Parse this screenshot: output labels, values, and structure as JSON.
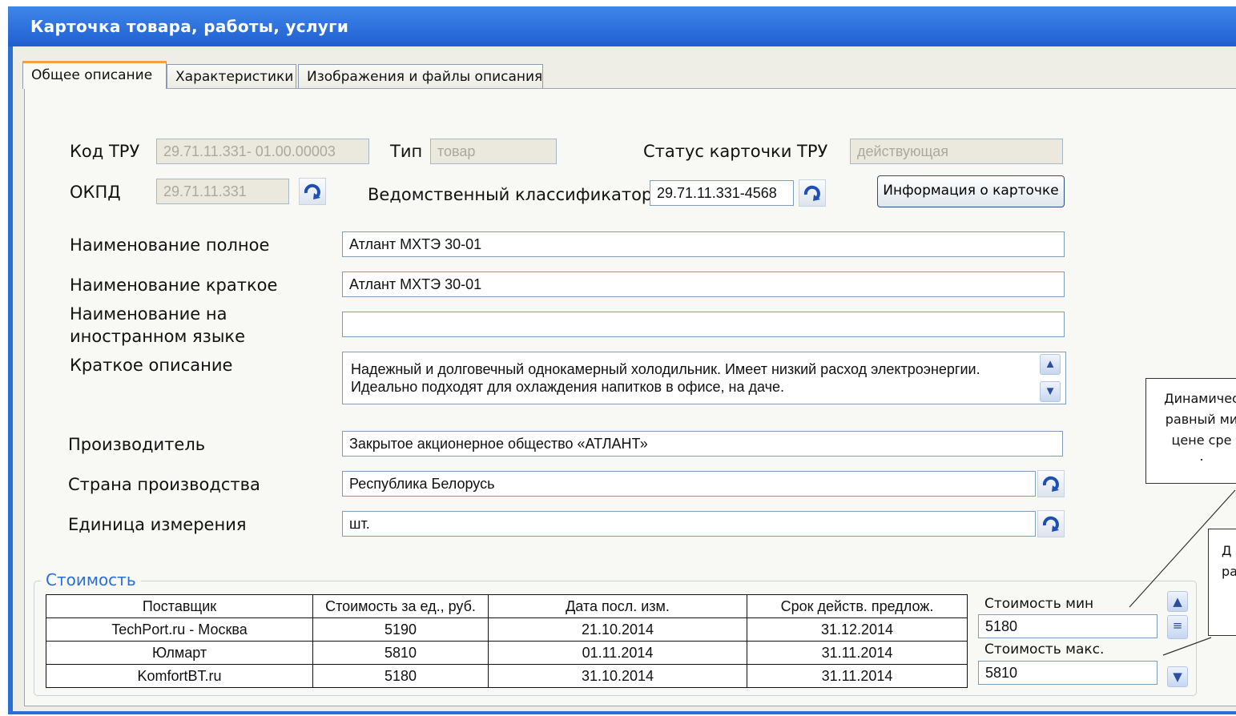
{
  "window": {
    "title": "Карточка товара, работы, услуги"
  },
  "tabs": [
    {
      "label": "Общее описание",
      "active": true
    },
    {
      "label": "Характеристики",
      "active": false
    },
    {
      "label": "Изображения и файлы описания",
      "active": false
    }
  ],
  "form": {
    "code": {
      "label": "Код ТРУ",
      "value": "29.71.11.331- 01.00.00003"
    },
    "type": {
      "label": "Тип",
      "value": "товар"
    },
    "status": {
      "label": "Статус карточки ТРУ",
      "value": "действующая"
    },
    "okpd": {
      "label": "ОКПД",
      "value": "29.71.11.331"
    },
    "dept_classifier": {
      "label": "Ведомственный классификатор",
      "value": "29.71.11.331-4568"
    },
    "info_button": "Информация о карточке",
    "name_full": {
      "label": "Наименование полное",
      "value": "Атлант МХТЭ 30-01"
    },
    "name_short": {
      "label": "Наименование краткое",
      "value": "Атлант МХТЭ 30-01"
    },
    "name_foreign": {
      "label_line1": "Наименование на",
      "label_line2": "иностранном языке",
      "value": ""
    },
    "description": {
      "label": "Краткое описание",
      "line1": "Надежный и долговечный однокамерный холодильник. Имеет низкий расход электроэнергии.",
      "line2": "Идеально подходят для охлаждения напитков в офисе, на даче."
    },
    "manufacturer": {
      "label": "Производитель",
      "value": "Закрытое акционерное общество «АТЛАНТ»"
    },
    "country": {
      "label": "Страна производства",
      "value": "Республика Белорусь"
    },
    "unit": {
      "label": "Единица измерения",
      "value": "шт."
    }
  },
  "cost": {
    "title": "Стоимость",
    "headers": [
      "Поставщик",
      "Стоимость за ед., руб.",
      "Дата посл. изм.",
      "Срок действ. предлож."
    ],
    "rows": [
      [
        "TechPort.ru - Москва",
        "5190",
        "21.10.2014",
        "31.12.2014"
      ],
      [
        "Юлмарт",
        "5810",
        "01.11.2014",
        "31.11.2014"
      ],
      [
        "KomfortBT.ru",
        "5180",
        "31.10.2014",
        "31.11.2014"
      ]
    ],
    "min_label": "Стоимость мин",
    "min_value": "5180",
    "max_label": "Стоимость макс.",
    "max_value": "5810"
  },
  "callouts": {
    "one": {
      "line1": "Динамичес",
      "line2": "равный ми",
      "line3": "цене сре",
      "line4": "."
    },
    "two": {
      "line1": "Д",
      "line2": "ра"
    }
  },
  "colors": {
    "titlebar": "#2a6fd6",
    "tab_active_accent": "#f2a23a",
    "group_title": "#2a6fd6"
  }
}
